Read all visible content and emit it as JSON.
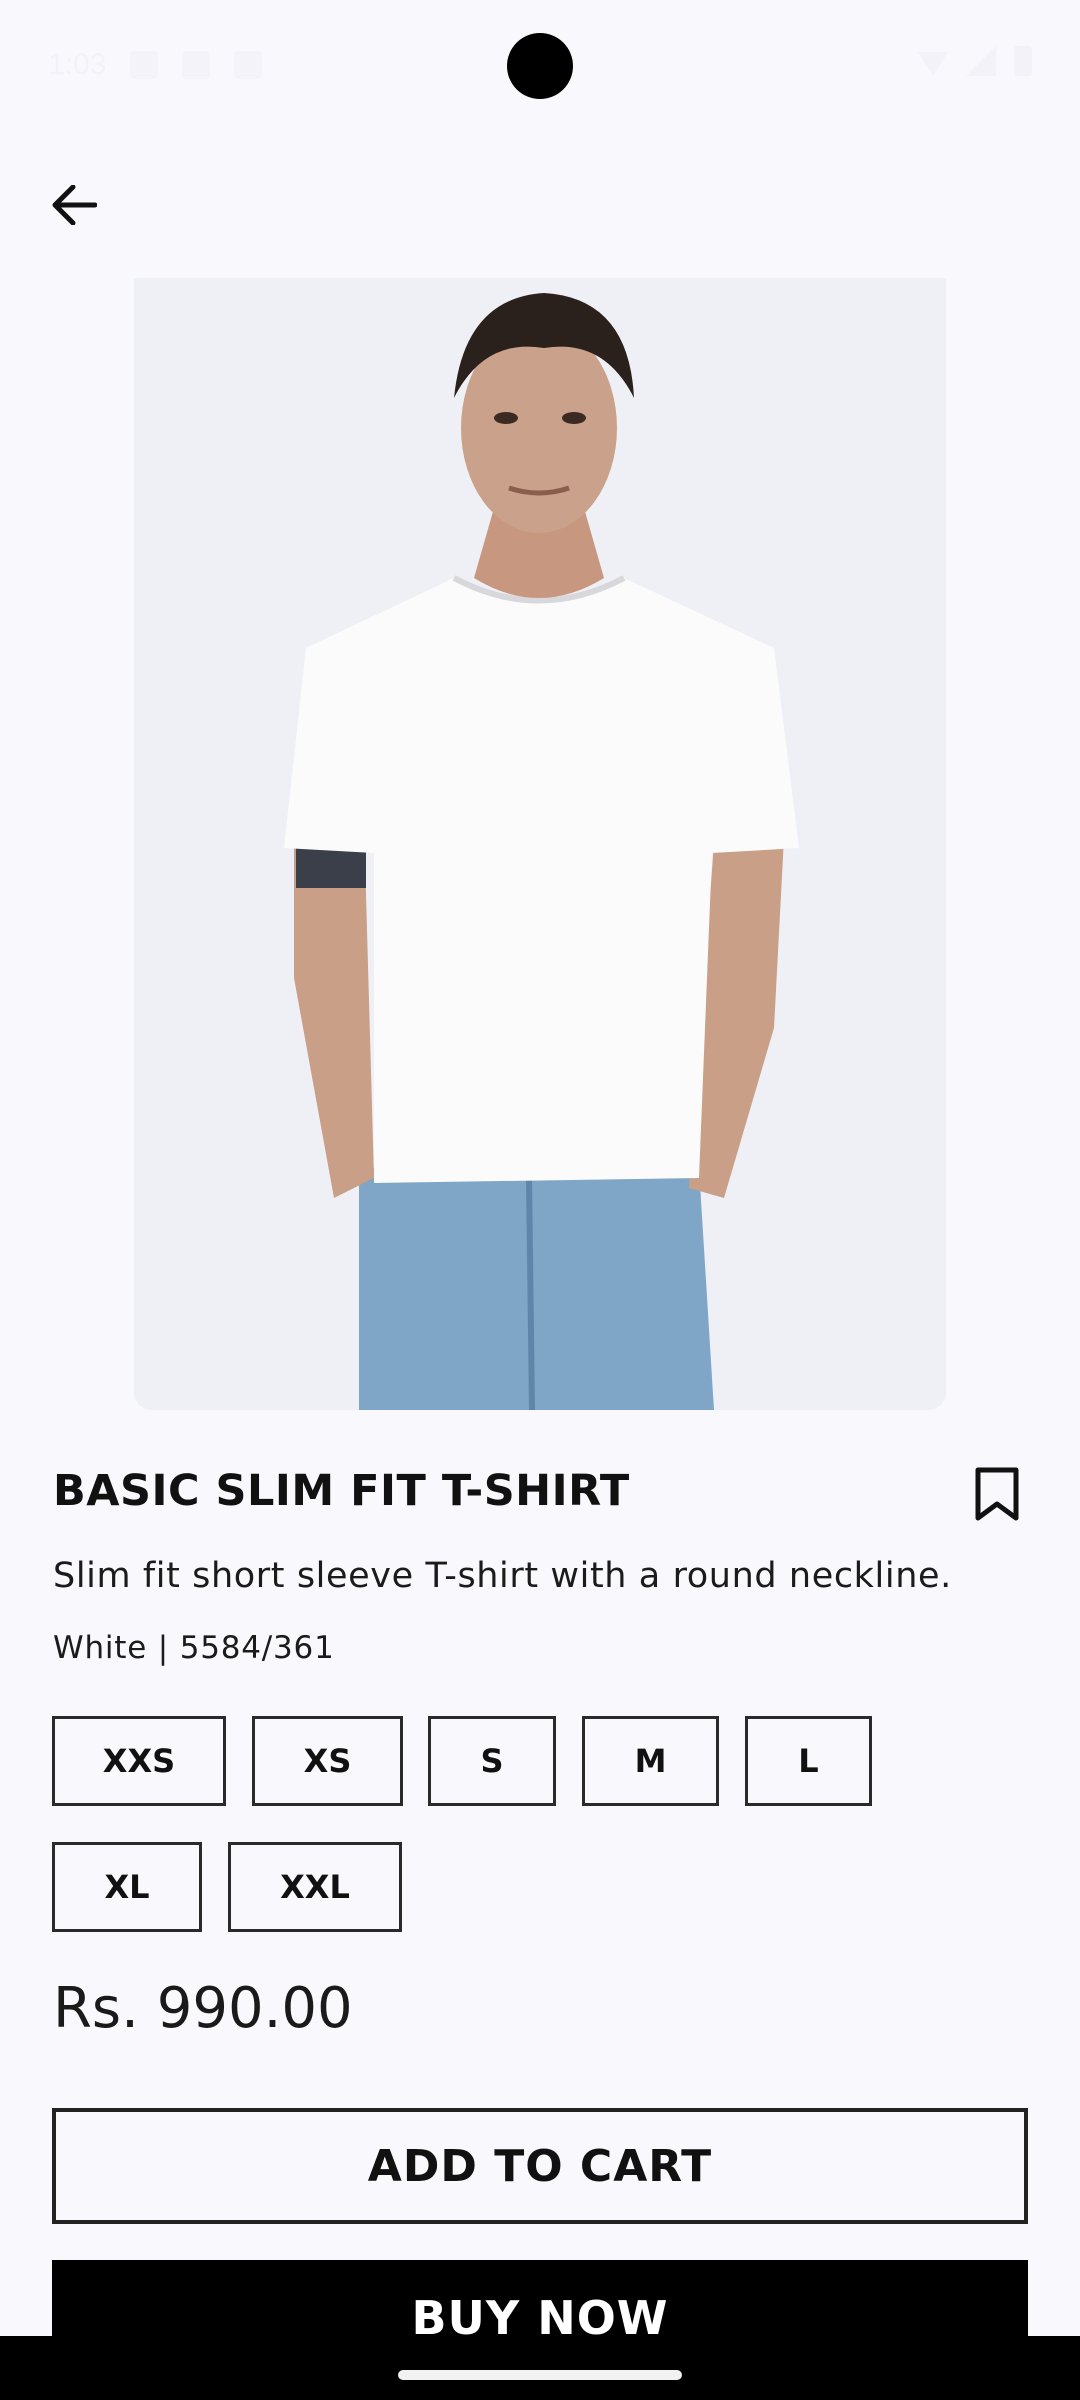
{
  "status_bar": {
    "time": "1:03"
  },
  "product": {
    "title": "BASIC SLIM FIT T-SHIRT",
    "description": "Slim fit short sleeve T-shirt with a round neckline.",
    "meta": "White | 5584/361",
    "sizes": [
      "XXS",
      "XS",
      "S",
      "M",
      "L",
      "XL",
      "XXL"
    ],
    "price": "Rs. 990.00"
  },
  "actions": {
    "add_to_cart": "ADD TO CART",
    "buy_now": "BUY NOW"
  },
  "icons": {
    "back": "arrow-left-icon",
    "bookmark": "bookmark-icon"
  },
  "colors": {
    "background": "#f9f8fd",
    "primary": "#000000",
    "image_bg": "#eff0f5"
  }
}
